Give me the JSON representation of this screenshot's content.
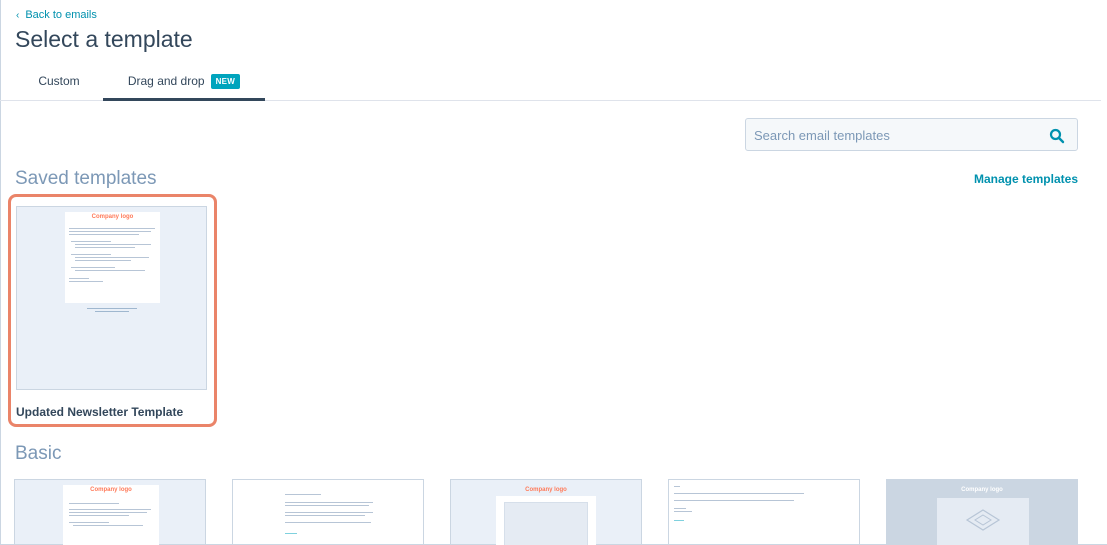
{
  "nav": {
    "back_label": "Back to emails"
  },
  "page": {
    "title": "Select a template"
  },
  "tabs": [
    {
      "label": "Custom"
    },
    {
      "label": "Drag and drop",
      "badge": "NEW"
    }
  ],
  "search": {
    "placeholder": "Search email templates"
  },
  "saved": {
    "title": "Saved templates",
    "manage_label": "Manage templates",
    "templates": [
      {
        "name": "Updated Newsletter Template",
        "logo_text": "Company logo"
      }
    ]
  },
  "basic": {
    "title": "Basic",
    "thumbnails": [
      {
        "logo_text": "Company logo"
      },
      {
        "logo_text": ""
      },
      {
        "logo_text": "Company logo"
      },
      {
        "logo_text": ""
      },
      {
        "logo_text": "Company logo"
      }
    ]
  },
  "colors": {
    "accent": "#0091ae",
    "badge": "#00a4bd",
    "highlight": "#ea8469",
    "logo": "#ff7a59"
  }
}
